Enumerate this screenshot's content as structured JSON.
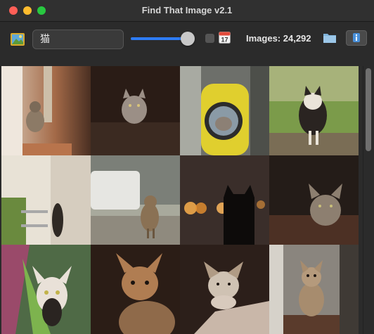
{
  "window": {
    "title": "Find That Image v2.1"
  },
  "toolbar": {
    "search_value": "猫",
    "slider_level": 0.9,
    "show_dates_checked": false,
    "images_count_label": "Images: 24,292"
  },
  "colors": {
    "accent": "#2e7cf6",
    "close": "#ff5f57",
    "minimize": "#febc2e",
    "zoom": "#28c840"
  },
  "icons": [
    "picture-icon",
    "calendar-icon",
    "folder-icon",
    "info-icon"
  ],
  "grid": {
    "columns": 4,
    "items": [
      "cat-on-stairs",
      "cat-dark-room",
      "cat-in-backpack",
      "cat-walking-grass",
      "cat-peeking-wall",
      "cat-walking-street",
      "cat-silhouette-bokeh",
      "cat-on-ledge",
      "cat-sphynx-plant",
      "cat-orange-looking-up",
      "kitten-paws-on-arm",
      "kitten-looking-up"
    ]
  }
}
